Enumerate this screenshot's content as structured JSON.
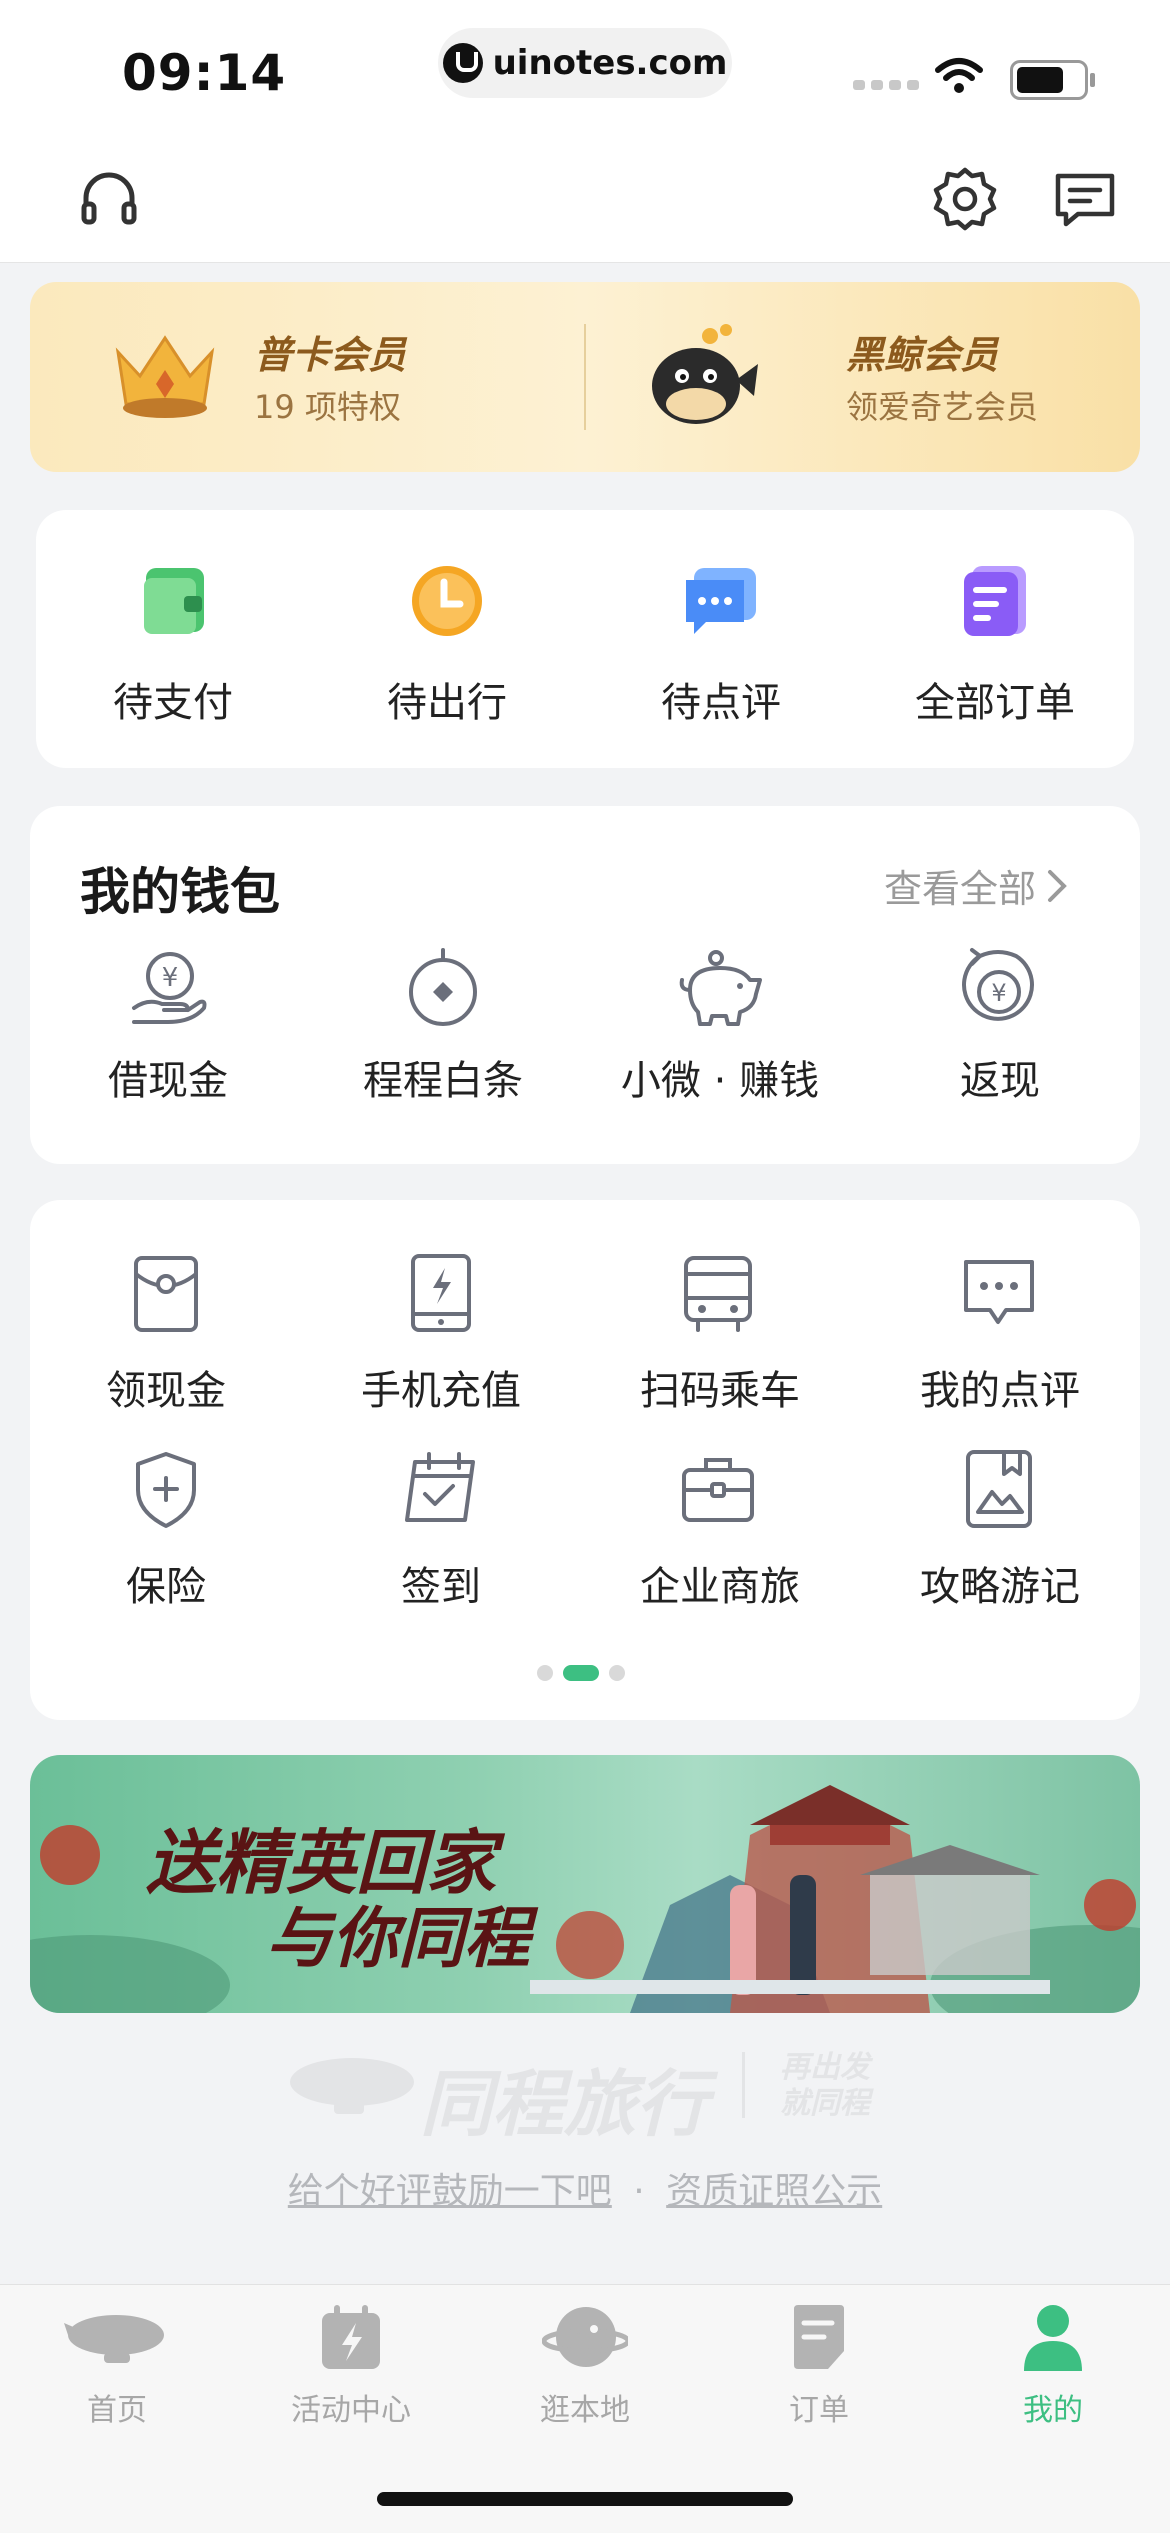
{
  "status_bar": {
    "time": "09:14",
    "url": "uinotes.com"
  },
  "nav": {
    "left_icon": "headset-icon",
    "right_icons": [
      "settings-icon",
      "message-icon"
    ]
  },
  "membership": [
    {
      "title": "普卡会员",
      "subtitle": "19 项特权",
      "icon": "crown-icon"
    },
    {
      "title": "黑鲸会员",
      "subtitle": "领爱奇艺会员",
      "icon": "whale-icon"
    }
  ],
  "orders": [
    {
      "label": "待支付",
      "icon": "wallet-icon",
      "color": "#4bc46f"
    },
    {
      "label": "待出行",
      "icon": "clock-icon",
      "color": "#f5a623"
    },
    {
      "label": "待点评",
      "icon": "chat-icon",
      "color": "#4a8cf7"
    },
    {
      "label": "全部订单",
      "icon": "document-icon",
      "color": "#8a5cf6"
    }
  ],
  "wallet": {
    "title": "我的钱包",
    "view_all": "查看全部",
    "items": [
      {
        "label": "借现金",
        "icon": "cash-hand-icon"
      },
      {
        "label": "程程白条",
        "icon": "credit-icon"
      },
      {
        "label": "小微 · 赚钱",
        "icon": "piggy-bank-icon"
      },
      {
        "label": "返现",
        "icon": "cashback-icon"
      }
    ]
  },
  "services": {
    "row1": [
      {
        "label": "领现金",
        "icon": "red-packet-icon"
      },
      {
        "label": "手机充值",
        "icon": "phone-charge-icon"
      },
      {
        "label": "扫码乘车",
        "icon": "bus-icon"
      },
      {
        "label": "我的点评",
        "icon": "comment-icon"
      }
    ],
    "row2": [
      {
        "label": "保险",
        "icon": "shield-icon"
      },
      {
        "label": "签到",
        "icon": "calendar-check-icon"
      },
      {
        "label": "企业商旅",
        "icon": "briefcase-icon"
      },
      {
        "label": "攻略游记",
        "icon": "bookmark-book-icon"
      }
    ],
    "page_count": 3,
    "active_page": 2
  },
  "banner": {
    "line1": "送精英回家",
    "line2": "与你同程"
  },
  "footer": {
    "logo": "同程旅行",
    "slogan_line1": "再出发",
    "slogan_line2": "就同程",
    "link1": "给个好评鼓励一下吧",
    "separator": "·",
    "link2": "资质证照公示"
  },
  "tabbar": [
    {
      "label": "首页",
      "icon": "blimp-icon",
      "active": false
    },
    {
      "label": "活动中心",
      "icon": "activity-icon",
      "active": false
    },
    {
      "label": "逛本地",
      "icon": "planet-icon",
      "active": false
    },
    {
      "label": "订单",
      "icon": "order-icon",
      "active": false
    },
    {
      "label": "我的",
      "icon": "person-icon",
      "active": true
    }
  ],
  "colors": {
    "accent": "#3dbf82",
    "gold": "#8c5a1d",
    "icon_stroke": "#6b6f7b"
  }
}
